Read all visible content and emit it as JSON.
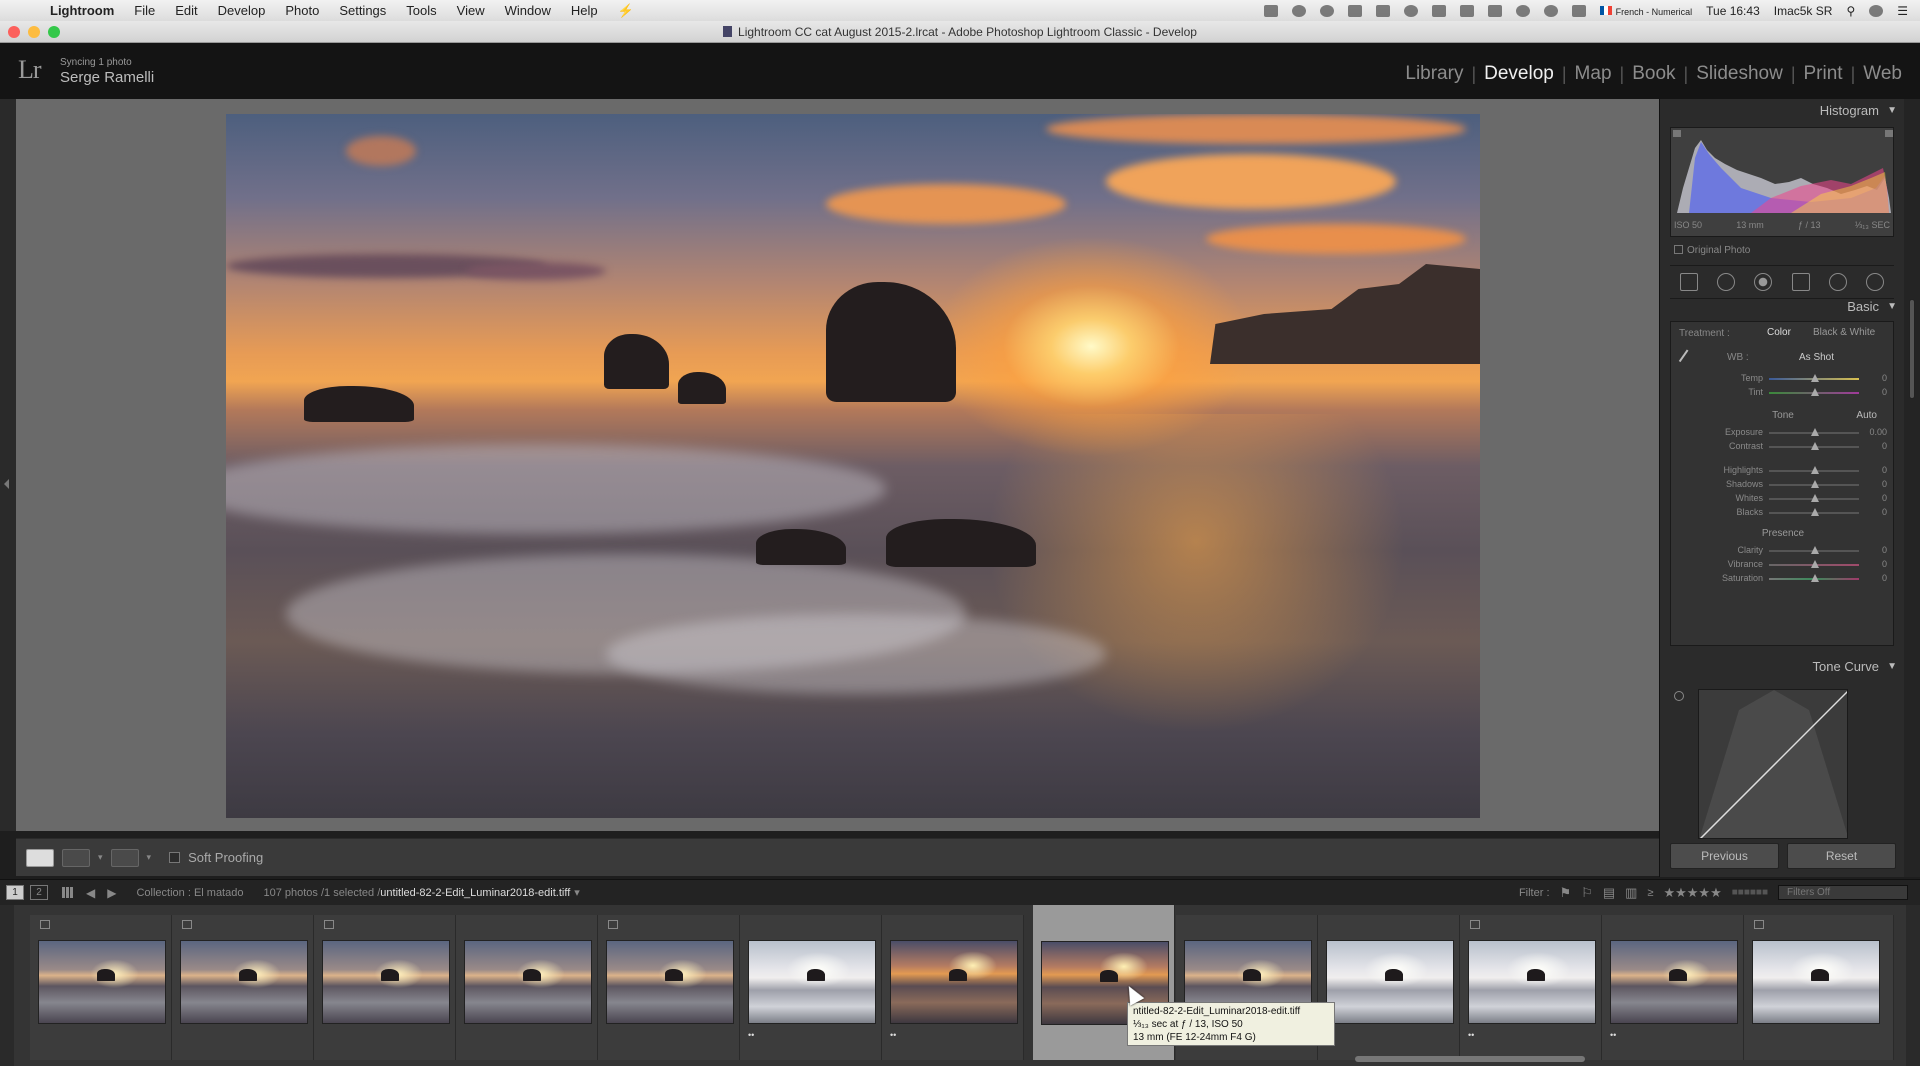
{
  "menubar": {
    "app": "Lightroom",
    "items": [
      "File",
      "Edit",
      "Develop",
      "Photo",
      "Settings",
      "Tools",
      "View",
      "Window",
      "Help"
    ],
    "keyboard": "French - Numerical",
    "clock": "Tue 16:43",
    "user": "Imac5k SR"
  },
  "window": {
    "title": "Lightroom CC cat August 2015-2.lrcat - Adobe Photoshop Lightroom Classic - Develop"
  },
  "identity": {
    "logo": "Lr",
    "sync": "Syncing 1 photo",
    "user": "Serge Ramelli"
  },
  "modules": [
    "Library",
    "Develop",
    "Map",
    "Book",
    "Slideshow",
    "Print",
    "Web"
  ],
  "active_module": "Develop",
  "toolbar": {
    "soft_proofing": "Soft Proofing"
  },
  "histogram": {
    "title": "Histogram",
    "iso": "ISO 50",
    "focal": "13 mm",
    "aperture": "ƒ / 13",
    "shutter": "⅓₁₃ SEC",
    "original_photo": "Original Photo"
  },
  "basic": {
    "title": "Basic",
    "treatment": "Treatment :",
    "color": "Color",
    "bw": "Black & White",
    "wb": "WB :",
    "wb_value": "As Shot",
    "tone": "Tone",
    "auto": "Auto",
    "presence": "Presence",
    "sliders": [
      {
        "label": "Temp",
        "value": "0"
      },
      {
        "label": "Tint",
        "value": "0"
      },
      {
        "label": "Exposure",
        "value": "0.00"
      },
      {
        "label": "Contrast",
        "value": "0"
      },
      {
        "label": "Highlights",
        "value": "0"
      },
      {
        "label": "Shadows",
        "value": "0"
      },
      {
        "label": "Whites",
        "value": "0"
      },
      {
        "label": "Blacks",
        "value": "0"
      },
      {
        "label": "Clarity",
        "value": "0"
      },
      {
        "label": "Vibrance",
        "value": "0"
      },
      {
        "label": "Saturation",
        "value": "0"
      }
    ]
  },
  "tone_curve": {
    "title": "Tone Curve"
  },
  "buttons": {
    "previous": "Previous",
    "reset": "Reset"
  },
  "filmstrip": {
    "screen1": "1",
    "screen2": "2",
    "collection": "Collection : El matado",
    "count": "107 photos /1 selected /",
    "filename": "untitled-82-2-Edit_Luminar2018-edit.tiff",
    "filter_label": "Filter :",
    "filter_stars_count": "≥",
    "filters_off": "Filters Off",
    "tooltip": {
      "line1": "ntitled-82-2-Edit_Luminar2018-edit.tiff",
      "line2": "⅓₁₃ sec at ƒ / 13, ISO 50",
      "line3": "13 mm (FE 12-24mm F4 G)"
    }
  },
  "colors": {
    "accent": "#f0f0f0",
    "panel": "#2b2b2b",
    "view_bg": "#6a6a6a"
  }
}
